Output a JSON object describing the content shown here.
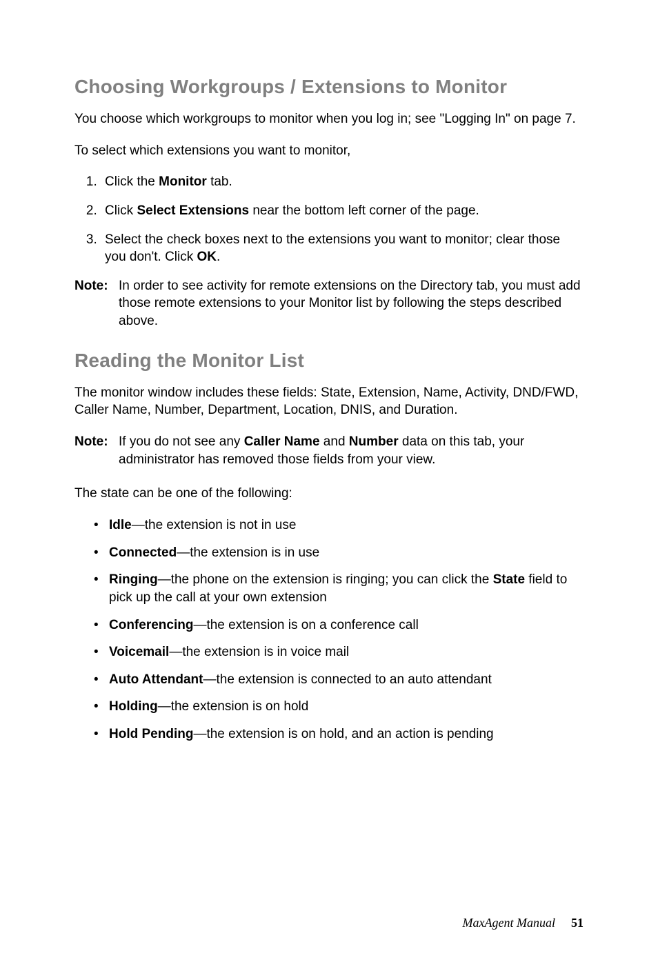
{
  "headings": {
    "choosing": "Choosing Workgroups / Extensions to Monitor",
    "reading": "Reading the Monitor List"
  },
  "section1": {
    "p1": "You choose which workgroups to monitor when you log in; see \"Logging In\" on page 7.",
    "p2": "To select which extensions you want to monitor,",
    "list": {
      "i1_a": "Click the ",
      "i1_b": "Monitor",
      "i1_c": " tab.",
      "i2_a": "Click ",
      "i2_b": "Select Extensions",
      "i2_c": " near the bottom left corner of the page.",
      "i3_a": "Select the check boxes next to the extensions you want to monitor; clear those you don't. Click ",
      "i3_b": "OK",
      "i3_c": "."
    },
    "note": {
      "label": "Note:",
      "body": "In order to see activity for remote extensions on the Directory tab, you must add those remote extensions to your Monitor list by following the steps described above."
    }
  },
  "section2": {
    "p1": "The monitor window includes these fields: State, Extension, Name, Activity, DND/FWD, Caller Name, Number, Department, Location, DNIS, and Duration.",
    "note": {
      "label": "Note:",
      "a": "If you do not see any ",
      "b": "Caller Name",
      "c": " and ",
      "d": "Number",
      "e": " data on this tab, your administrator has removed those fields from your view."
    },
    "p2": "The state can be one of the following:",
    "bullets": {
      "idle_b": "Idle",
      "idle_t": "—the extension is not in use",
      "conn_b": "Connected",
      "conn_t": "—the extension is in use",
      "ring_b": "Ringing",
      "ring_t1": "—the phone on the extension is ringing; you can click the ",
      "ring_state": "State",
      "ring_t2": " field to pick up the call at your own extension",
      "conf_b": "Conferencing",
      "conf_t": "—the extension is on a conference call",
      "vm_b": "Voicemail",
      "vm_t": "—the extension is in voice mail",
      "aa_b": "Auto Attendant",
      "aa_t": "—the extension is connected to an auto attendant",
      "hold_b": "Holding",
      "hold_t": "—the extension is on hold",
      "hp_b": "Hold Pending",
      "hp_t": "—the extension is on hold, and an action is pending"
    }
  },
  "footer": {
    "title": "MaxAgent Manual",
    "page": "51"
  }
}
